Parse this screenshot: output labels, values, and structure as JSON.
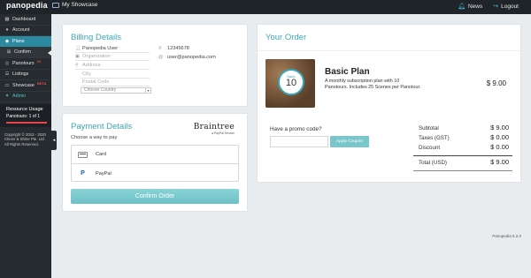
{
  "topbar": {
    "logo_main": "panopedia",
    "showcase": "My Showcase",
    "news": "News",
    "logout": "Logout"
  },
  "sidebar": {
    "items": [
      {
        "label": "Dashboard",
        "icon": "dashboard-icon"
      },
      {
        "label": "Account",
        "icon": "user-icon"
      },
      {
        "label": "Plans",
        "icon": "tag-icon"
      },
      {
        "label": "Confirm",
        "icon": "shopping-cart-icon"
      },
      {
        "label": "Panotours",
        "icon": "globe-icon",
        "badge": "V2"
      },
      {
        "label": "Listings",
        "icon": "list-icon"
      },
      {
        "label": "Showcase",
        "icon": "monitor-icon",
        "badge": "BETA"
      },
      {
        "label": "Admin",
        "icon": "admin-icon"
      }
    ],
    "resource": {
      "title": "Resource Usage",
      "value": "Panotours: 1 of 1"
    },
    "copyright": [
      "Copyright © 2013 - 2020",
      "Clever & Shine Pte. Ltd.",
      "All Rights Reserved."
    ]
  },
  "billing": {
    "title": "Billing Details",
    "name": "Panopedia User",
    "organization_ph": "Organization",
    "address_ph": "Address",
    "city_ph": "City",
    "postal_ph": "Postal Code",
    "country_ph": "Choose Country",
    "phone": "12345678",
    "email": "user@panopedia.com"
  },
  "payment": {
    "title": "Payment Details",
    "braintree": "Braintree",
    "braintree_sub": "a PayPal Service",
    "choose": "Choose a way to pay",
    "option_card": "Card",
    "option_paypal": "PayPal",
    "confirm": "Confirm Order"
  },
  "order": {
    "title": "Your Order",
    "badge_top": "Basic",
    "badge_num": "10",
    "plan_name": "Basic Plan",
    "plan_desc": "A monthly subscription plan with 10 Panotours. Includes 25 Scenes per Panotour.",
    "plan_price": "$ 9.00",
    "promo_label": "Have a promo code?",
    "promo_button": "Apply Coupon",
    "subtotal_label": "Subtotal",
    "subtotal": "$ 9.00",
    "taxes_label": "Taxes (GST)",
    "taxes": "$ 0.00",
    "discount_label": "Discount",
    "discount": "$ 0.00",
    "total_label": "Total (USD)",
    "total": "$ 9.00"
  },
  "footer": {
    "version": "Panopedia 5.2.0"
  },
  "colors": {
    "accent": "#3aa6b9",
    "sidebar": "#262b2f",
    "topbar": "#1f2428",
    "danger": "#e8434a"
  }
}
